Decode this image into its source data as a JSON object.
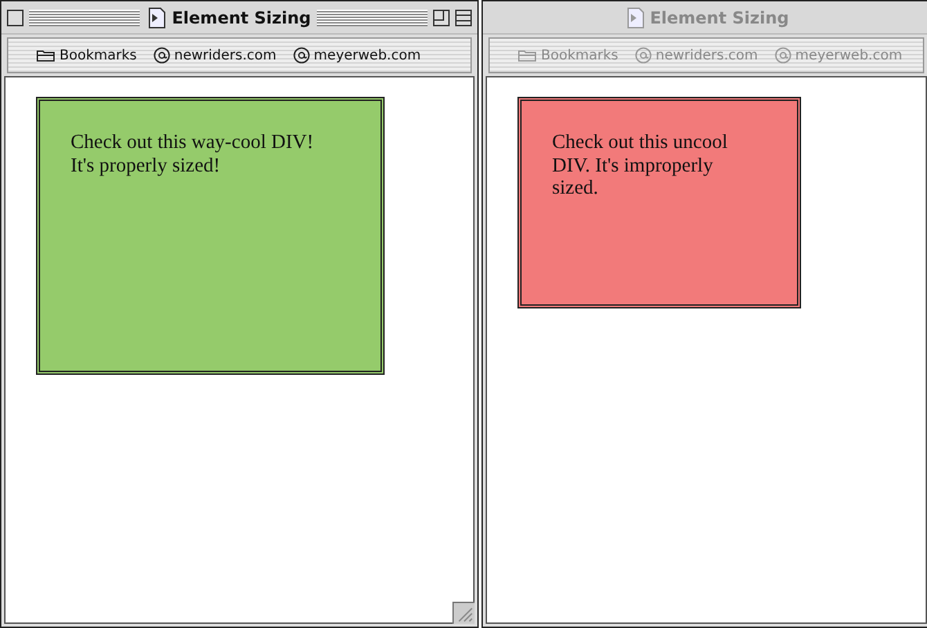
{
  "windows": [
    {
      "title": "Element Sizing",
      "active": true,
      "bookmarks": [
        {
          "kind": "folder",
          "label": "Bookmarks"
        },
        {
          "kind": "site",
          "label": "newriders.com"
        },
        {
          "kind": "site",
          "label": "meyerweb.com"
        }
      ],
      "box": {
        "text": "Check out this way-cool DIV! It's properly sized!",
        "color": "#95cb6b"
      }
    },
    {
      "title": "Element Sizing",
      "active": false,
      "bookmarks": [
        {
          "kind": "folder",
          "label": "Bookmarks"
        },
        {
          "kind": "site",
          "label": "newriders.com"
        },
        {
          "kind": "site",
          "label": "meyerweb.com"
        }
      ],
      "box": {
        "text": "Check out this uncool DIV. It's improperly sized.",
        "color": "#f27a7a"
      }
    }
  ]
}
